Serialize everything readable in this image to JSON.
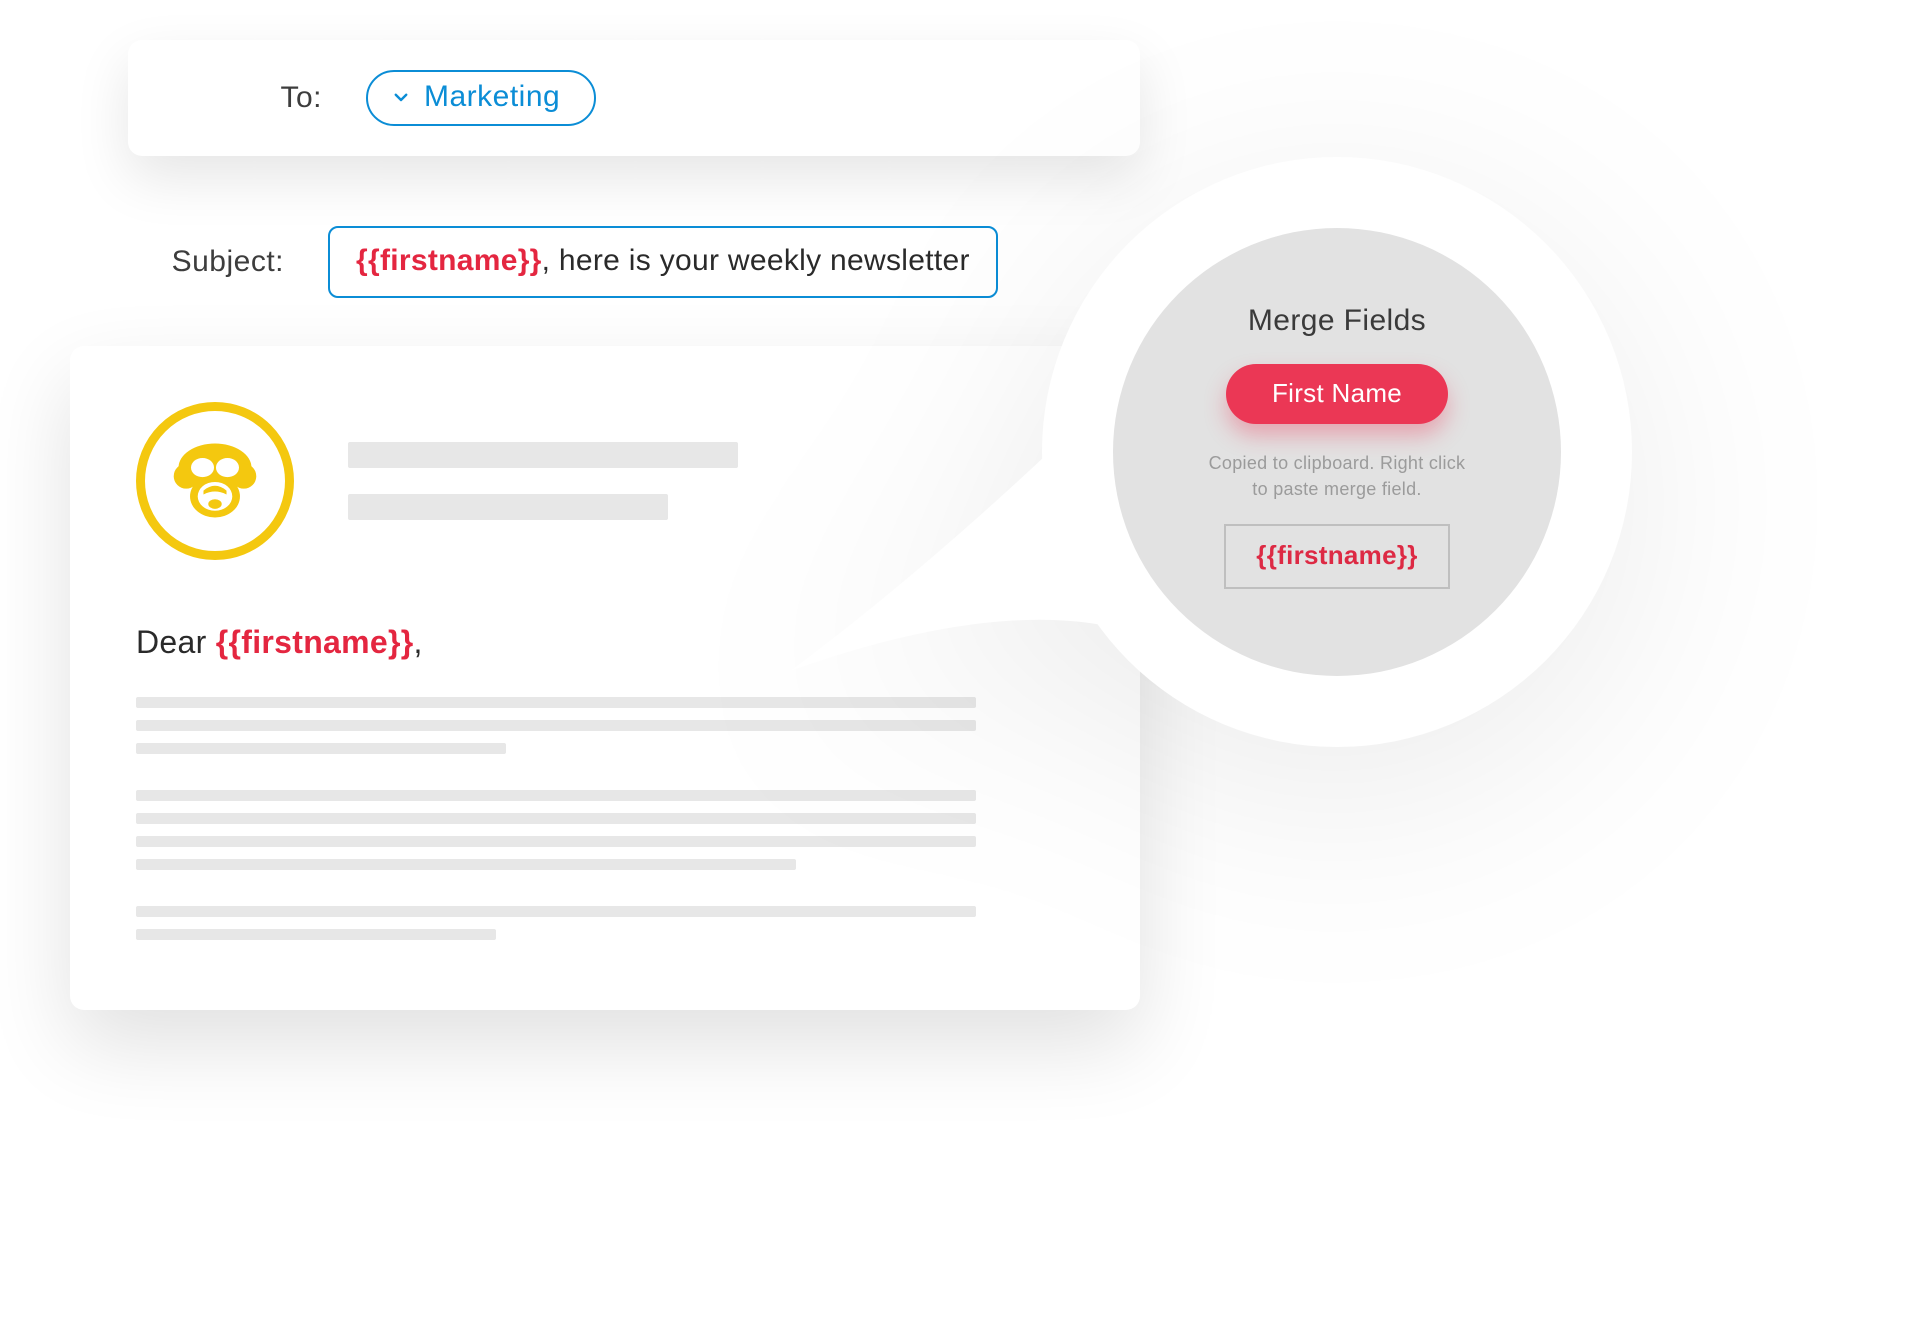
{
  "to": {
    "label": "To:",
    "chip": "Marketing"
  },
  "subject": {
    "label": "Subject:",
    "token": "{{firstname}}",
    "rest": ", here is your weekly newsletter"
  },
  "body": {
    "greeting_prefix": "Dear ",
    "greeting_token": "{{firstname}}",
    "greeting_suffix": ","
  },
  "callout": {
    "title": "Merge Fields",
    "button": "First Name",
    "hint_l1": "Copied to clipboard. Right click",
    "hint_l2": "to paste merge field.",
    "code": "{{firstname}}"
  },
  "colors": {
    "accent_blue": "#0b8dd6",
    "merge_red": "#e42640",
    "pill_red": "#eb3755",
    "logo_yellow": "#f4c80f",
    "gray_bar": "#e7e7e7",
    "callout_bg": "#e2e2e2"
  }
}
